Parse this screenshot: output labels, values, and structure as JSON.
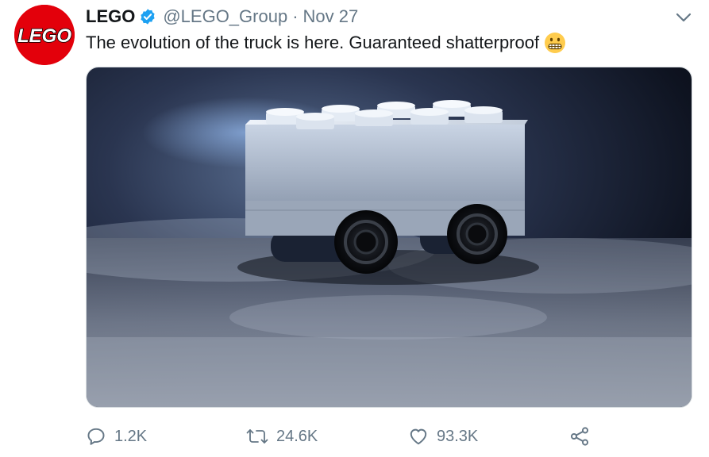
{
  "tweet": {
    "author_name": "LEGO",
    "avatar_logo_text": "LEGO",
    "handle": "@LEGO_Group",
    "separator": "·",
    "date": "Nov 27",
    "text": "The evolution of the truck is here. Guaranteed shatterproof",
    "emoji_name": "grimacing-face-emoji",
    "media_description_icon": "lego-brick-truck-image",
    "verified_icon": "verified-badge-icon",
    "more_icon": "chevron-down-icon"
  },
  "actions": {
    "reply": {
      "icon": "reply-icon",
      "count": "1.2K"
    },
    "retweet": {
      "icon": "retweet-icon",
      "count": "24.6K"
    },
    "like": {
      "icon": "heart-icon",
      "count": "93.3K"
    },
    "share": {
      "icon": "share-icon"
    }
  },
  "colors": {
    "brand_red": "#e3000b",
    "verified_blue": "#1da1f2",
    "secondary_text": "#657786",
    "primary_text": "#14171a"
  }
}
